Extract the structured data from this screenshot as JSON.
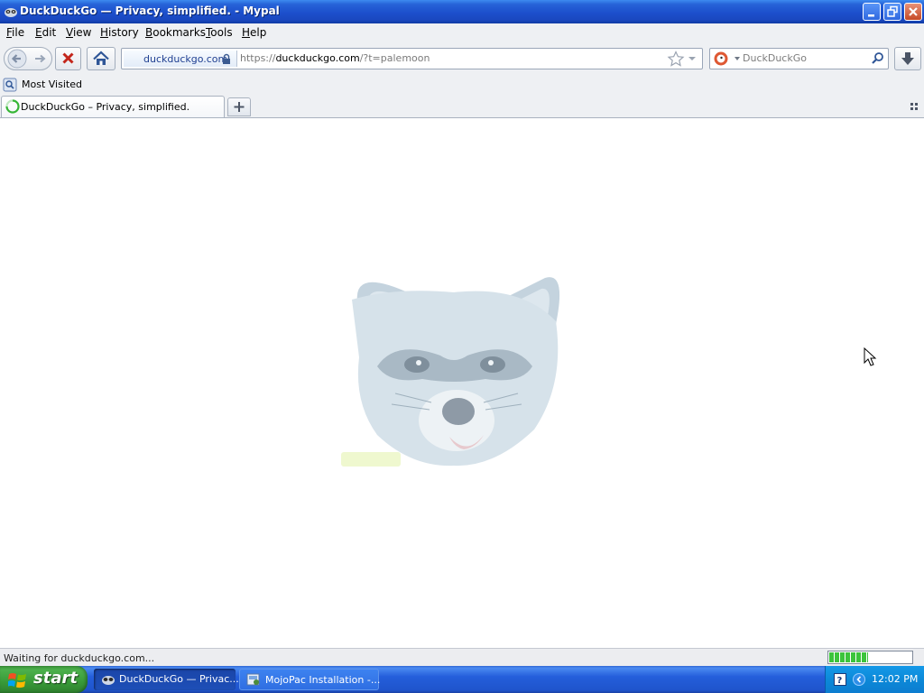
{
  "window": {
    "title": "DuckDuckGo — Privacy, simplified. - Mypal"
  },
  "menubar": {
    "items": [
      {
        "label": "File",
        "accel": "F",
        "rest": "ile"
      },
      {
        "label": "Edit",
        "accel": "E",
        "rest": "dit"
      },
      {
        "label": "View",
        "accel": "V",
        "rest": "iew"
      },
      {
        "label": "History",
        "accel": "H",
        "rest": "istory"
      },
      {
        "label": "Bookmarks",
        "accel": "B",
        "rest": "ookmarks"
      },
      {
        "label": "Tools",
        "accel": "T",
        "rest": "ools"
      },
      {
        "label": "Help",
        "accel": "H",
        "rest": "elp"
      }
    ]
  },
  "navbar": {
    "identity_label": "duckduckgo.com",
    "url_prefix": "https://",
    "url_host": "duckduckgo.com",
    "url_rest": "/?t=palemoon",
    "search_placeholder": "DuckDuckGo"
  },
  "bookmarks": {
    "most_visited": "Most Visited"
  },
  "tabs": {
    "active_title": "DuckDuckGo – Privacy, simplified."
  },
  "status": {
    "text": "Waiting for duckduckgo.com...",
    "progress_percent": 47
  },
  "taskbar": {
    "start_label": "start",
    "tasks": [
      {
        "label": "DuckDuckGo — Privac..."
      },
      {
        "label": "MojoPac Installation -..."
      }
    ],
    "clock": "12:02 PM"
  },
  "colors": {
    "titlebar": "#1c4fcc",
    "progress_fill": "#3cc43c",
    "start_green": "#3c9a3c",
    "taskbar_blue": "#245edb"
  }
}
